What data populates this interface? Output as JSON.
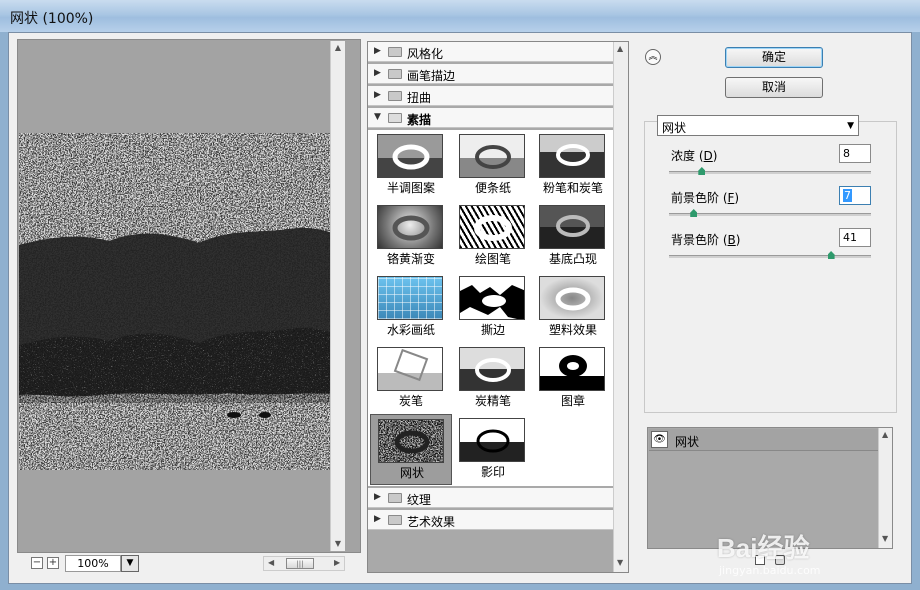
{
  "window": {
    "title": "网状 (100%)"
  },
  "preview": {
    "zoom": "100%",
    "zoom_out": "−",
    "zoom_in": "+",
    "hscroll_thumb": "|||"
  },
  "gallery": {
    "categories_top": [
      {
        "label": "风格化",
        "open": false
      },
      {
        "label": "画笔描边",
        "open": false
      },
      {
        "label": "扭曲",
        "open": false
      },
      {
        "label": "素描",
        "open": true
      }
    ],
    "thumbnails": [
      {
        "label": "半调图案",
        "selected": false
      },
      {
        "label": "便条纸",
        "selected": false
      },
      {
        "label": "粉笔和炭笔",
        "selected": false
      },
      {
        "label": "铬黄渐变",
        "selected": false
      },
      {
        "label": "绘图笔",
        "selected": false
      },
      {
        "label": "基底凸现",
        "selected": false
      },
      {
        "label": "水彩画纸",
        "selected": false
      },
      {
        "label": "撕边",
        "selected": false
      },
      {
        "label": "塑料效果",
        "selected": false
      },
      {
        "label": "炭笔",
        "selected": false
      },
      {
        "label": "炭精笔",
        "selected": false
      },
      {
        "label": "图章",
        "selected": false
      },
      {
        "label": "网状",
        "selected": true
      },
      {
        "label": "影印",
        "selected": false
      }
    ],
    "categories_bottom": [
      {
        "label": "纹理",
        "open": false
      },
      {
        "label": "艺术效果",
        "open": false
      }
    ]
  },
  "buttons": {
    "ok": "确定",
    "cancel": "取消"
  },
  "settings": {
    "filter_select": "网状",
    "params": [
      {
        "label": "浓度",
        "hotkey": "D",
        "value": "8",
        "level": 0.16
      },
      {
        "label": "前景色阶",
        "hotkey": "F",
        "value": "7",
        "level": 0.12
      },
      {
        "label": "背景色阶",
        "hotkey": "B",
        "value": "41",
        "level": 0.8
      }
    ]
  },
  "layers": {
    "items": [
      {
        "name": "网状"
      }
    ]
  },
  "watermark": {
    "brand": "Bai经验",
    "url": "jingyan.baidu.com"
  }
}
